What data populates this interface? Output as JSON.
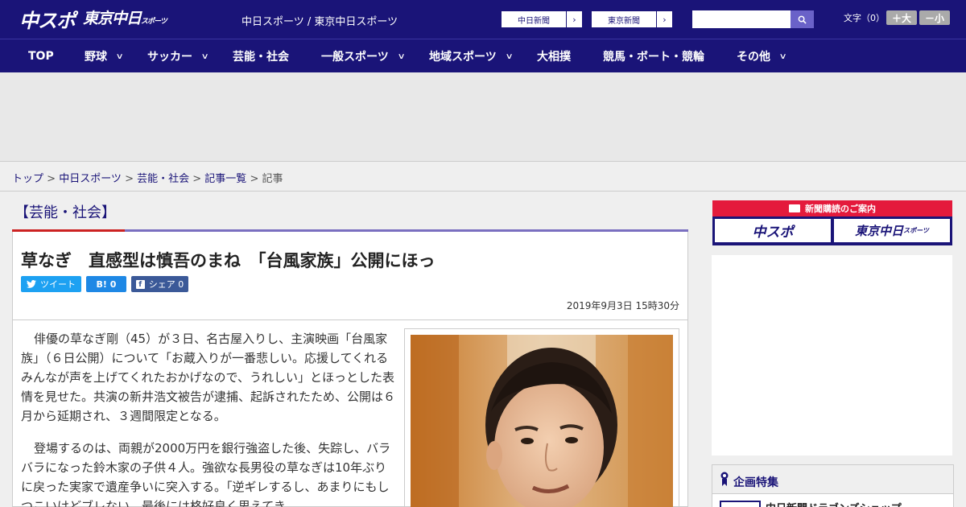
{
  "header": {
    "logo_main": "中スポ",
    "logo_sub": "東京中日",
    "logo_sub_small": "スポーツ",
    "site_title": "中日スポーツ / 東京中日スポーツ",
    "link_chunichi": "中日新聞",
    "link_tokyo": "東京新聞",
    "arrow": "›",
    "search_placeholder": "",
    "search_icon": "search-icon",
    "fontsize_label": "文字（0）",
    "fontsize_up": "＋大",
    "fontsize_down": "－小"
  },
  "nav": {
    "items": [
      {
        "label": "TOP",
        "has_menu": false
      },
      {
        "label": "野球",
        "has_menu": true
      },
      {
        "label": "サッカー",
        "has_menu": true
      },
      {
        "label": "芸能・社会",
        "has_menu": false
      },
      {
        "label": "一般スポーツ",
        "has_menu": true
      },
      {
        "label": "地域スポーツ",
        "has_menu": true
      },
      {
        "label": "大相撲",
        "has_menu": false
      },
      {
        "label": "競馬・ボート・競輪",
        "has_menu": false
      },
      {
        "label": "その他",
        "has_menu": true
      }
    ],
    "chevron": "∨"
  },
  "breadcrumb": {
    "items": [
      "トップ",
      "中日スポーツ",
      "芸能・社会",
      "記事一覧"
    ],
    "current": "記事",
    "separator": " > "
  },
  "article": {
    "category": "【芸能・社会】",
    "headline": "草なぎ　直感型は慎吾のまね　「台風家族」公開にほっ",
    "share": {
      "tweet": "ツイート",
      "hatena": "B! 0",
      "facebook": "シェア 0"
    },
    "date": "2019年9月3日 15時30分",
    "paragraphs": [
      "俳優の草なぎ剛（45）が３日、名古屋入りし、主演映画「台風家族」（６日公開）について「お蔵入りが一番悲しい。応援してくれるみんなが声を上げてくれたおかげなので、うれしい」とほっとした表情を見せた。共演の新井浩文被告が逮捕、起訴されたため、公開は６月から延期され、３週間限定となる。",
      "登場するのは、両親が2000万円を銀行強盗した後、失踪し、バラバラになった鈴木家の子供４人。強欲な長男役の草なぎは10年ぶりに戻った実家で遺産争いに突入する。「逆ギレするし、あまりにもしつこいけどブレない。最後には格好良く思えてき"
    ]
  },
  "sidebar": {
    "subscription_head": "新聞購読のご案内",
    "sub_logo_1": "中スポ",
    "sub_logo_2": "東京中日",
    "sub_logo_2_small": "スポーツ",
    "feature_title": "企画特集",
    "feature_item": "中日新聞ドラゴンズショップ"
  },
  "colors": {
    "brand_navy": "#1a1478",
    "accent_red": "#e41a3c",
    "twitter_blue": "#1da1f2",
    "facebook_blue": "#3b5998"
  }
}
